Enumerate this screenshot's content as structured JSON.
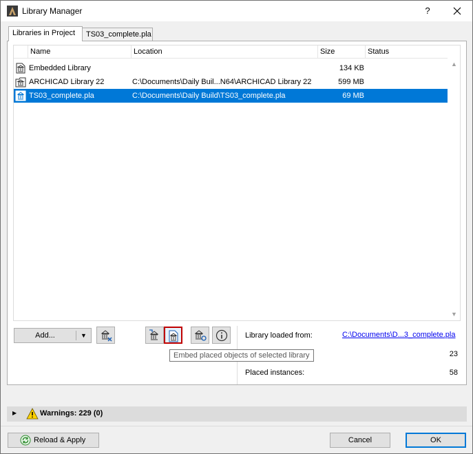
{
  "window": {
    "title": "Library Manager",
    "help_glyph": "?",
    "close_glyph": "✕"
  },
  "tabs": [
    {
      "label": "Libraries in Project",
      "active": true
    },
    {
      "label": "TS03_complete.pla",
      "active": false
    }
  ],
  "list": {
    "columns": {
      "name": "Name",
      "location": "Location",
      "size": "Size",
      "status": "Status"
    },
    "rows": [
      {
        "icon": "embedded-library-icon",
        "name": "Embedded Library",
        "location": "",
        "size": "134 KB",
        "status": "",
        "selected": false
      },
      {
        "icon": "library-folder-icon",
        "name": "ARCHICAD Library 22",
        "location": "C:\\Documents\\Daily Buil...N64\\ARCHICAD Library 22",
        "size": "599 MB",
        "status": "",
        "selected": false
      },
      {
        "icon": "library-container-icon",
        "name": "TS03_complete.pla",
        "location": "C:\\Documents\\Daily Build\\TS03_complete.pla",
        "size": "69 MB",
        "status": "",
        "selected": true
      }
    ]
  },
  "toolbar": {
    "add_label": "Add...",
    "tooltip": "Embed placed objects of selected library"
  },
  "info": {
    "loaded_from_label": "Library loaded from:",
    "loaded_from_value": "C:\\Documents\\D...3_complete.pla",
    "count_value": "23",
    "placed_instances_label": "Placed instances:",
    "placed_instances_value": "58"
  },
  "warnings": {
    "label": "Warnings: 229 (0)"
  },
  "footer": {
    "reload_label": "Reload & Apply",
    "cancel_label": "Cancel",
    "ok_label": "OK"
  },
  "colors": {
    "selection": "#0078d7",
    "highlight_border": "#c00000",
    "link": "#0000ee"
  }
}
